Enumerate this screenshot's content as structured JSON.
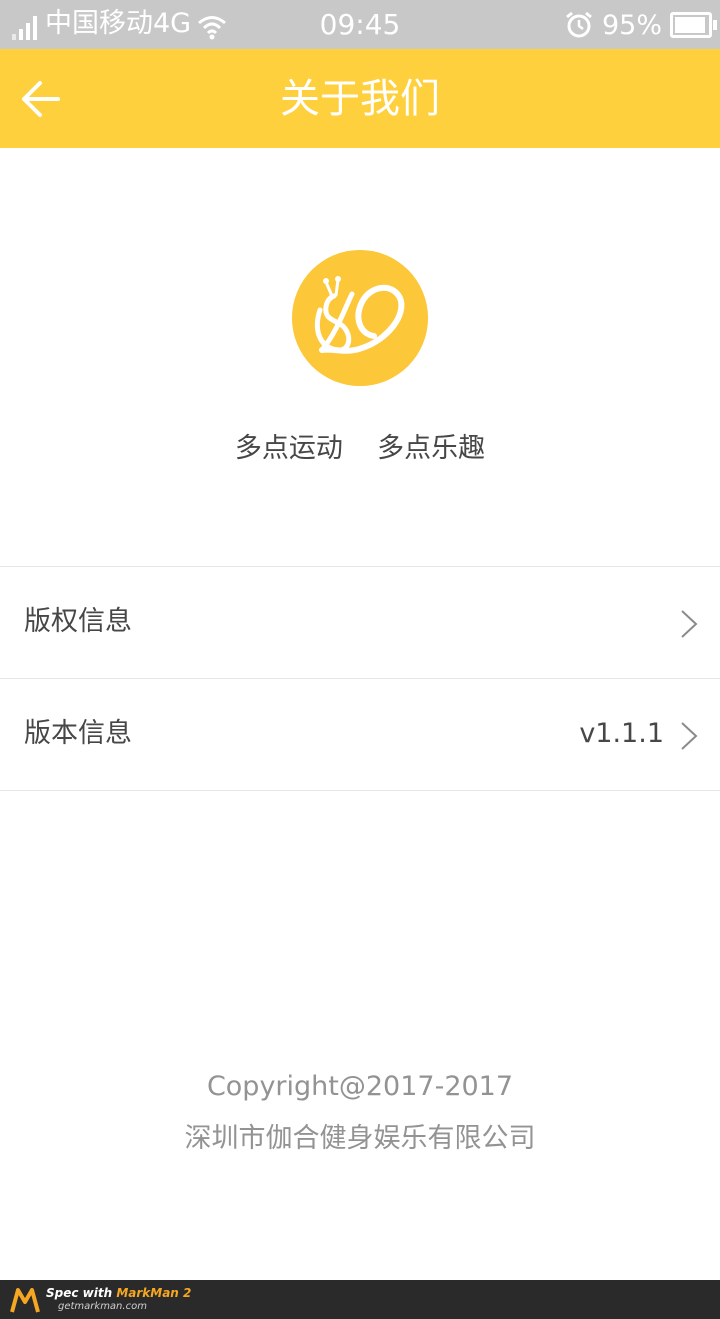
{
  "status_bar": {
    "carrier": "中国移动4G",
    "time": "09:45",
    "battery": "95%",
    "icons": [
      "signal-icon",
      "wifi-icon",
      "alarm-icon",
      "battery-icon"
    ]
  },
  "header": {
    "title": "关于我们",
    "back_icon": "arrow-left-icon"
  },
  "logo": {
    "icon": "snail-logo-icon",
    "color": "#fdc73a"
  },
  "slogan": "多点运动    多点乐趣",
  "list": {
    "items": [
      {
        "label": "版权信息",
        "value": ""
      },
      {
        "label": "版本信息",
        "value": "v1.1.1"
      }
    ]
  },
  "footer": {
    "copyright": "Copyright@2017-2017",
    "company": "深圳市伽合健身娱乐有限公司"
  },
  "watermark": {
    "line1_prefix": "Spec with ",
    "line1_brand": "MarkMan 2",
    "line2": "getmarkman.com"
  },
  "colors": {
    "header_bg": "#ffd03d",
    "title_text": "#ffffff",
    "body_text": "#474747",
    "footer_text": "#939393"
  }
}
